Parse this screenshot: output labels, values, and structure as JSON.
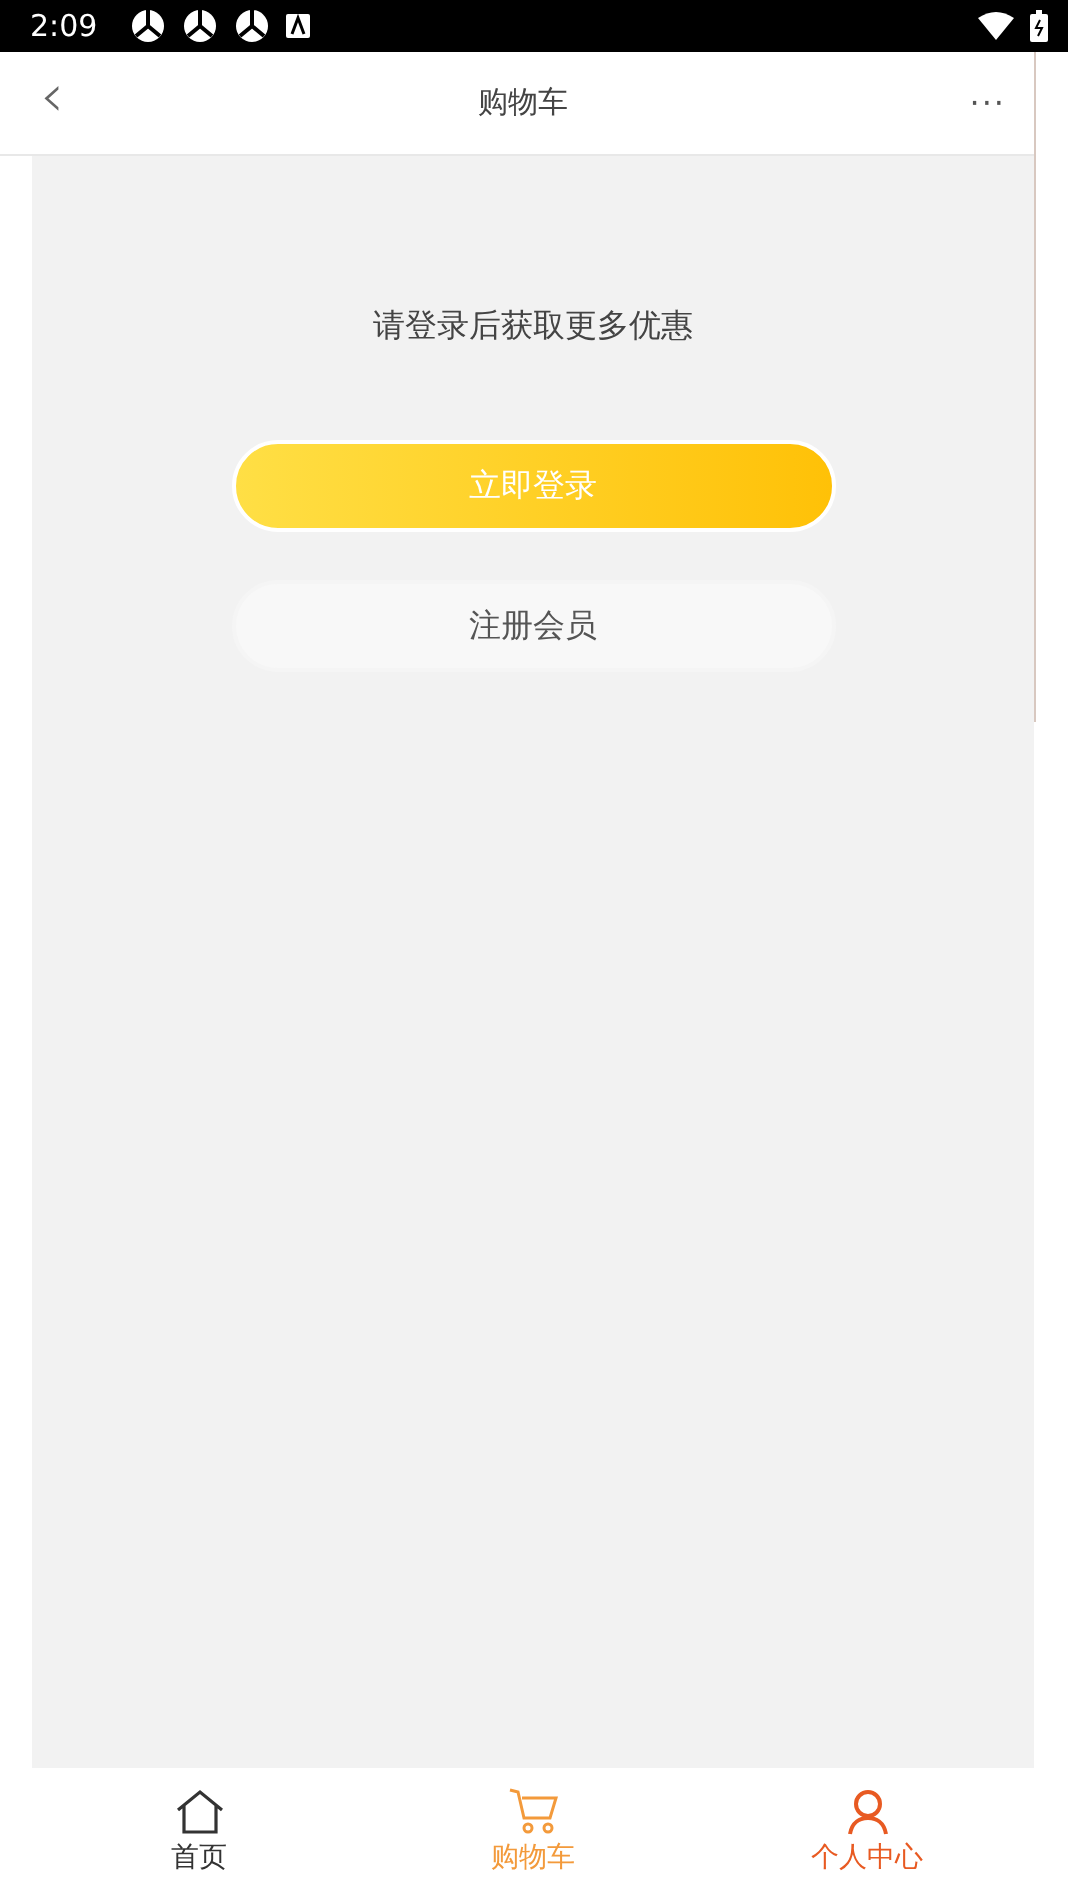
{
  "status_bar": {
    "time": "2:09"
  },
  "header": {
    "back": "‹",
    "title": "购物车",
    "more": "···"
  },
  "prompt": "请登录后获取更多优惠",
  "buttons": [
    {
      "kind": "primary",
      "label": "立即登录"
    },
    {
      "kind": "secondary",
      "label": "注册会员"
    }
  ],
  "tab_bar": [
    {
      "label": "首页",
      "kind": "home",
      "color": "#333333"
    },
    {
      "label": "购物车",
      "kind": "cart",
      "color": "#f39a3b"
    },
    {
      "label": "个人中心",
      "kind": "person",
      "color": "#e85a22"
    }
  ]
}
